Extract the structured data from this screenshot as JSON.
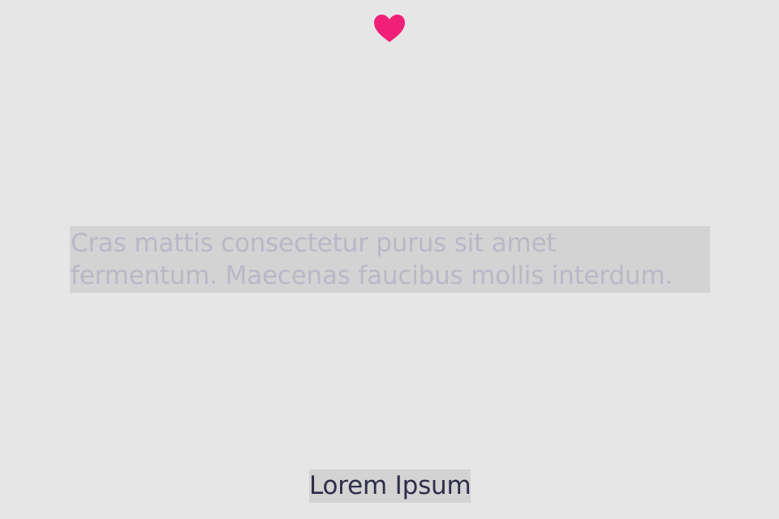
{
  "content": {
    "text": "Cras mattis consectetur purus sit amet fermentum. Maecenas faucibus mollis interdum."
  },
  "footer": {
    "button_label": "Lorem Ipsum"
  },
  "icons": {
    "heart": "heart-icon"
  },
  "colors": {
    "background": "#e6e6e6",
    "heart": "#f02078",
    "text_block_background": "#d3d3d3",
    "text_color": "#b8b8c8",
    "button_text": "#2d2d4a"
  }
}
